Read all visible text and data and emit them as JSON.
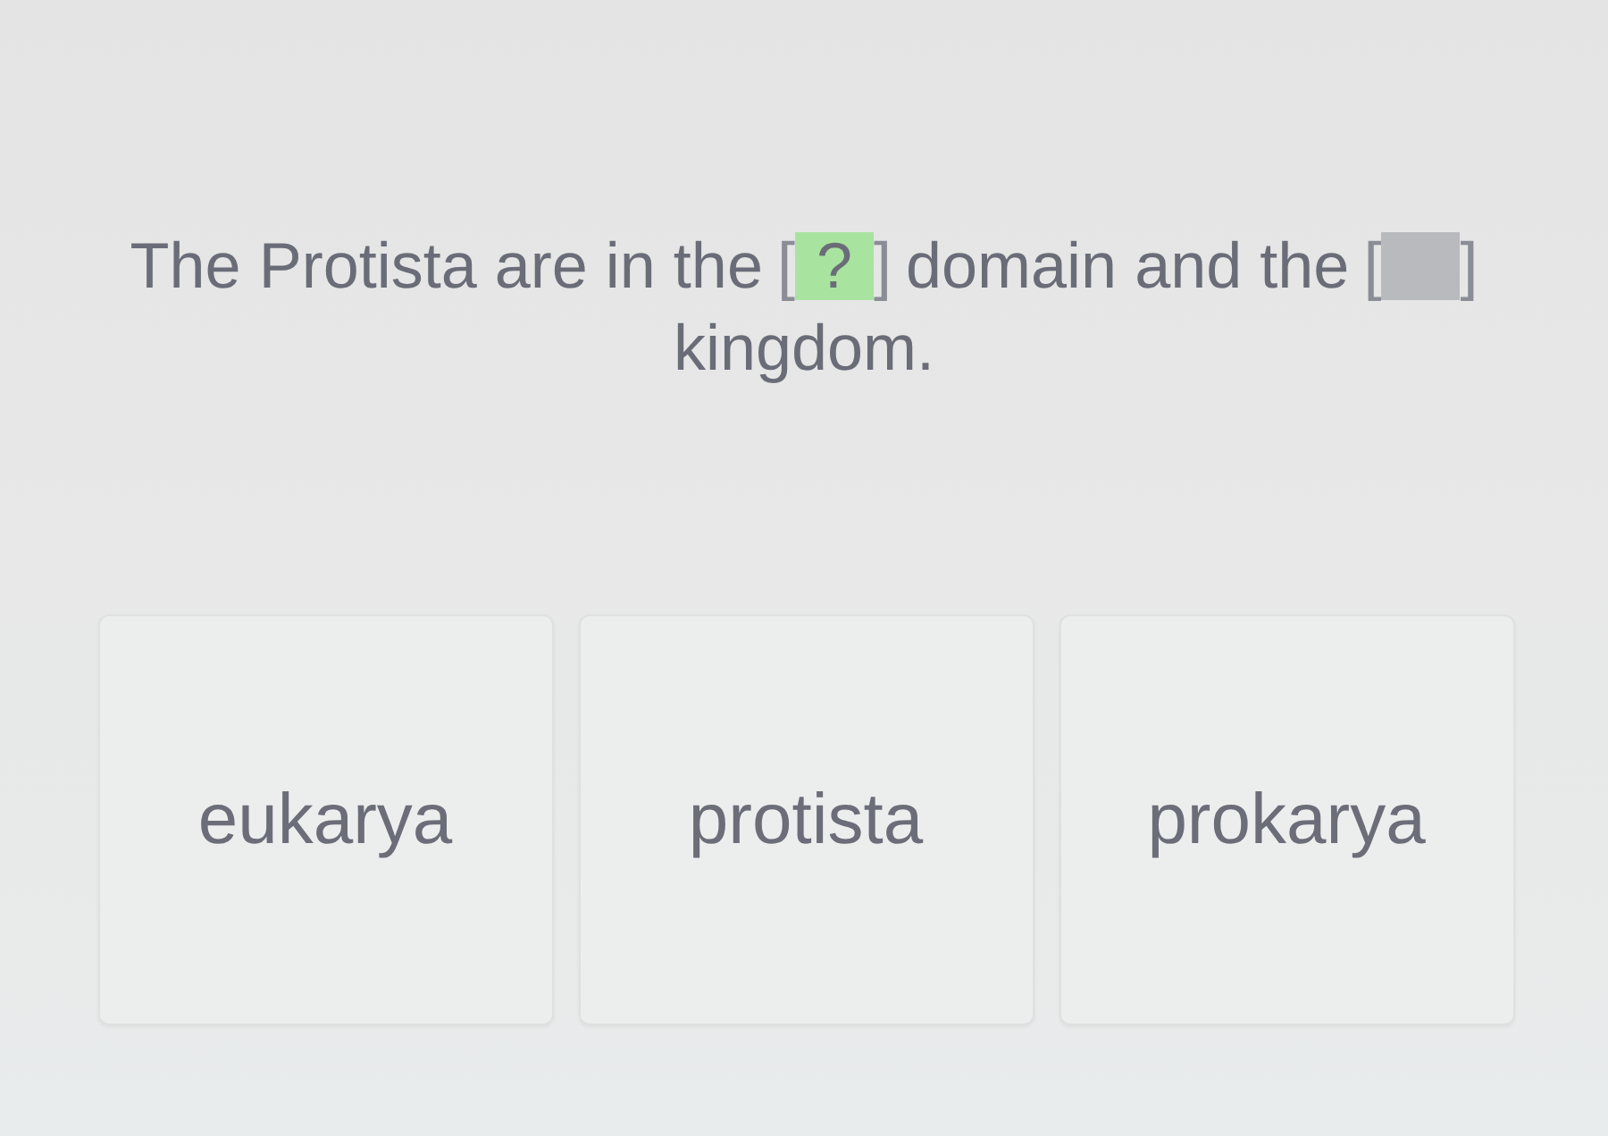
{
  "question": {
    "parts": [
      {
        "kind": "text",
        "text": "The Protista are in the"
      },
      {
        "kind": "blank",
        "open": "[",
        "text": "?",
        "close": "]",
        "selected": true
      },
      {
        "kind": "text",
        "text": "domain and the"
      },
      {
        "kind": "blank",
        "open": "[",
        "close": "]",
        "selected": false
      },
      {
        "kind": "text",
        "text": "kingdom."
      }
    ]
  },
  "choices": [
    {
      "label": "eukarya"
    },
    {
      "label": "protista"
    },
    {
      "label": "prokarya"
    }
  ]
}
